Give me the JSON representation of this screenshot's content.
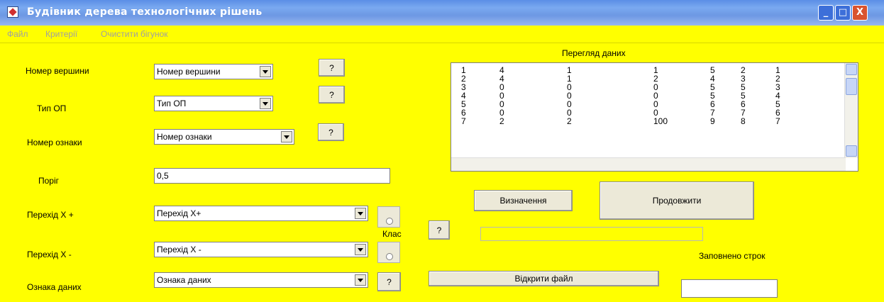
{
  "window": {
    "title": "Будівник дерева технологічних рішень",
    "buttons": {
      "minimize": "_",
      "maximize": "□",
      "close": "X"
    }
  },
  "menu": [
    "Файл",
    "Критерії",
    "Очистити бігунок"
  ],
  "form": {
    "vertex_label": "Номер вершини",
    "vertex_value": "Номер вершини",
    "op_type_label": "Тип ОП",
    "op_type_value": "Тип ОП",
    "feature_label": "Номер ознаки",
    "feature_value": "Номер ознаки",
    "threshold_label": "Поріг",
    "threshold_value": "0,5",
    "xplus_label": "Перехід Х +",
    "xplus_value": "Перехід Х+",
    "xminus_label": "Перехід Х -",
    "xminus_value": "Перехід Х -",
    "datasign_label": "Ознака даних",
    "datasign_value": "Ознака даних",
    "class_label": "Клас",
    "help": "?"
  },
  "data_view": {
    "title": "Перегляд даних",
    "rows": [
      [
        "1",
        "4",
        "1",
        "1",
        "5",
        "2",
        "1"
      ],
      [
        "2",
        "4",
        "1",
        "2",
        "4",
        "3",
        "2"
      ],
      [
        "3",
        "0",
        "0",
        "0",
        "5",
        "5",
        "3"
      ],
      [
        "4",
        "0",
        "0",
        "0",
        "5",
        "5",
        "4"
      ],
      [
        "5",
        "0",
        "0",
        "0",
        "6",
        "6",
        "5"
      ],
      [
        "6",
        "0",
        "0",
        "0",
        "7",
        "7",
        "6"
      ],
      [
        "7",
        "2",
        "2",
        "100",
        "9",
        "8",
        "7"
      ]
    ]
  },
  "actions": {
    "define": "Визначення",
    "continue": "Продовжити",
    "open_file": "Відкрити файл",
    "rows_filled_label": "Заповнено строк",
    "rows_filled_value": ""
  },
  "colors": {
    "background": "#ffff00",
    "titlebar": "#6d98e4",
    "button": "#ece9d8"
  }
}
